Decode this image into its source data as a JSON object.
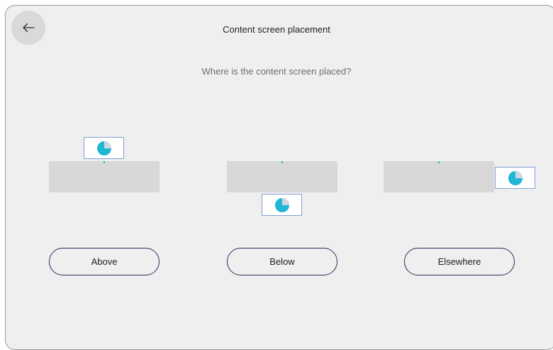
{
  "header": {
    "title": "Content screen placement",
    "back_icon": "arrow-left-icon"
  },
  "question": "Where is the content screen placed?",
  "colors": {
    "background": "#efefef",
    "screen": "#d8d8d8",
    "accent": "#1fb7d5",
    "button_border": "#2c2f5c"
  },
  "options": [
    {
      "label": "Above",
      "icon": "pie-chart-icon"
    },
    {
      "label": "Below",
      "icon": "pie-chart-icon"
    },
    {
      "label": "Elsewhere",
      "icon": "pie-chart-icon"
    }
  ]
}
